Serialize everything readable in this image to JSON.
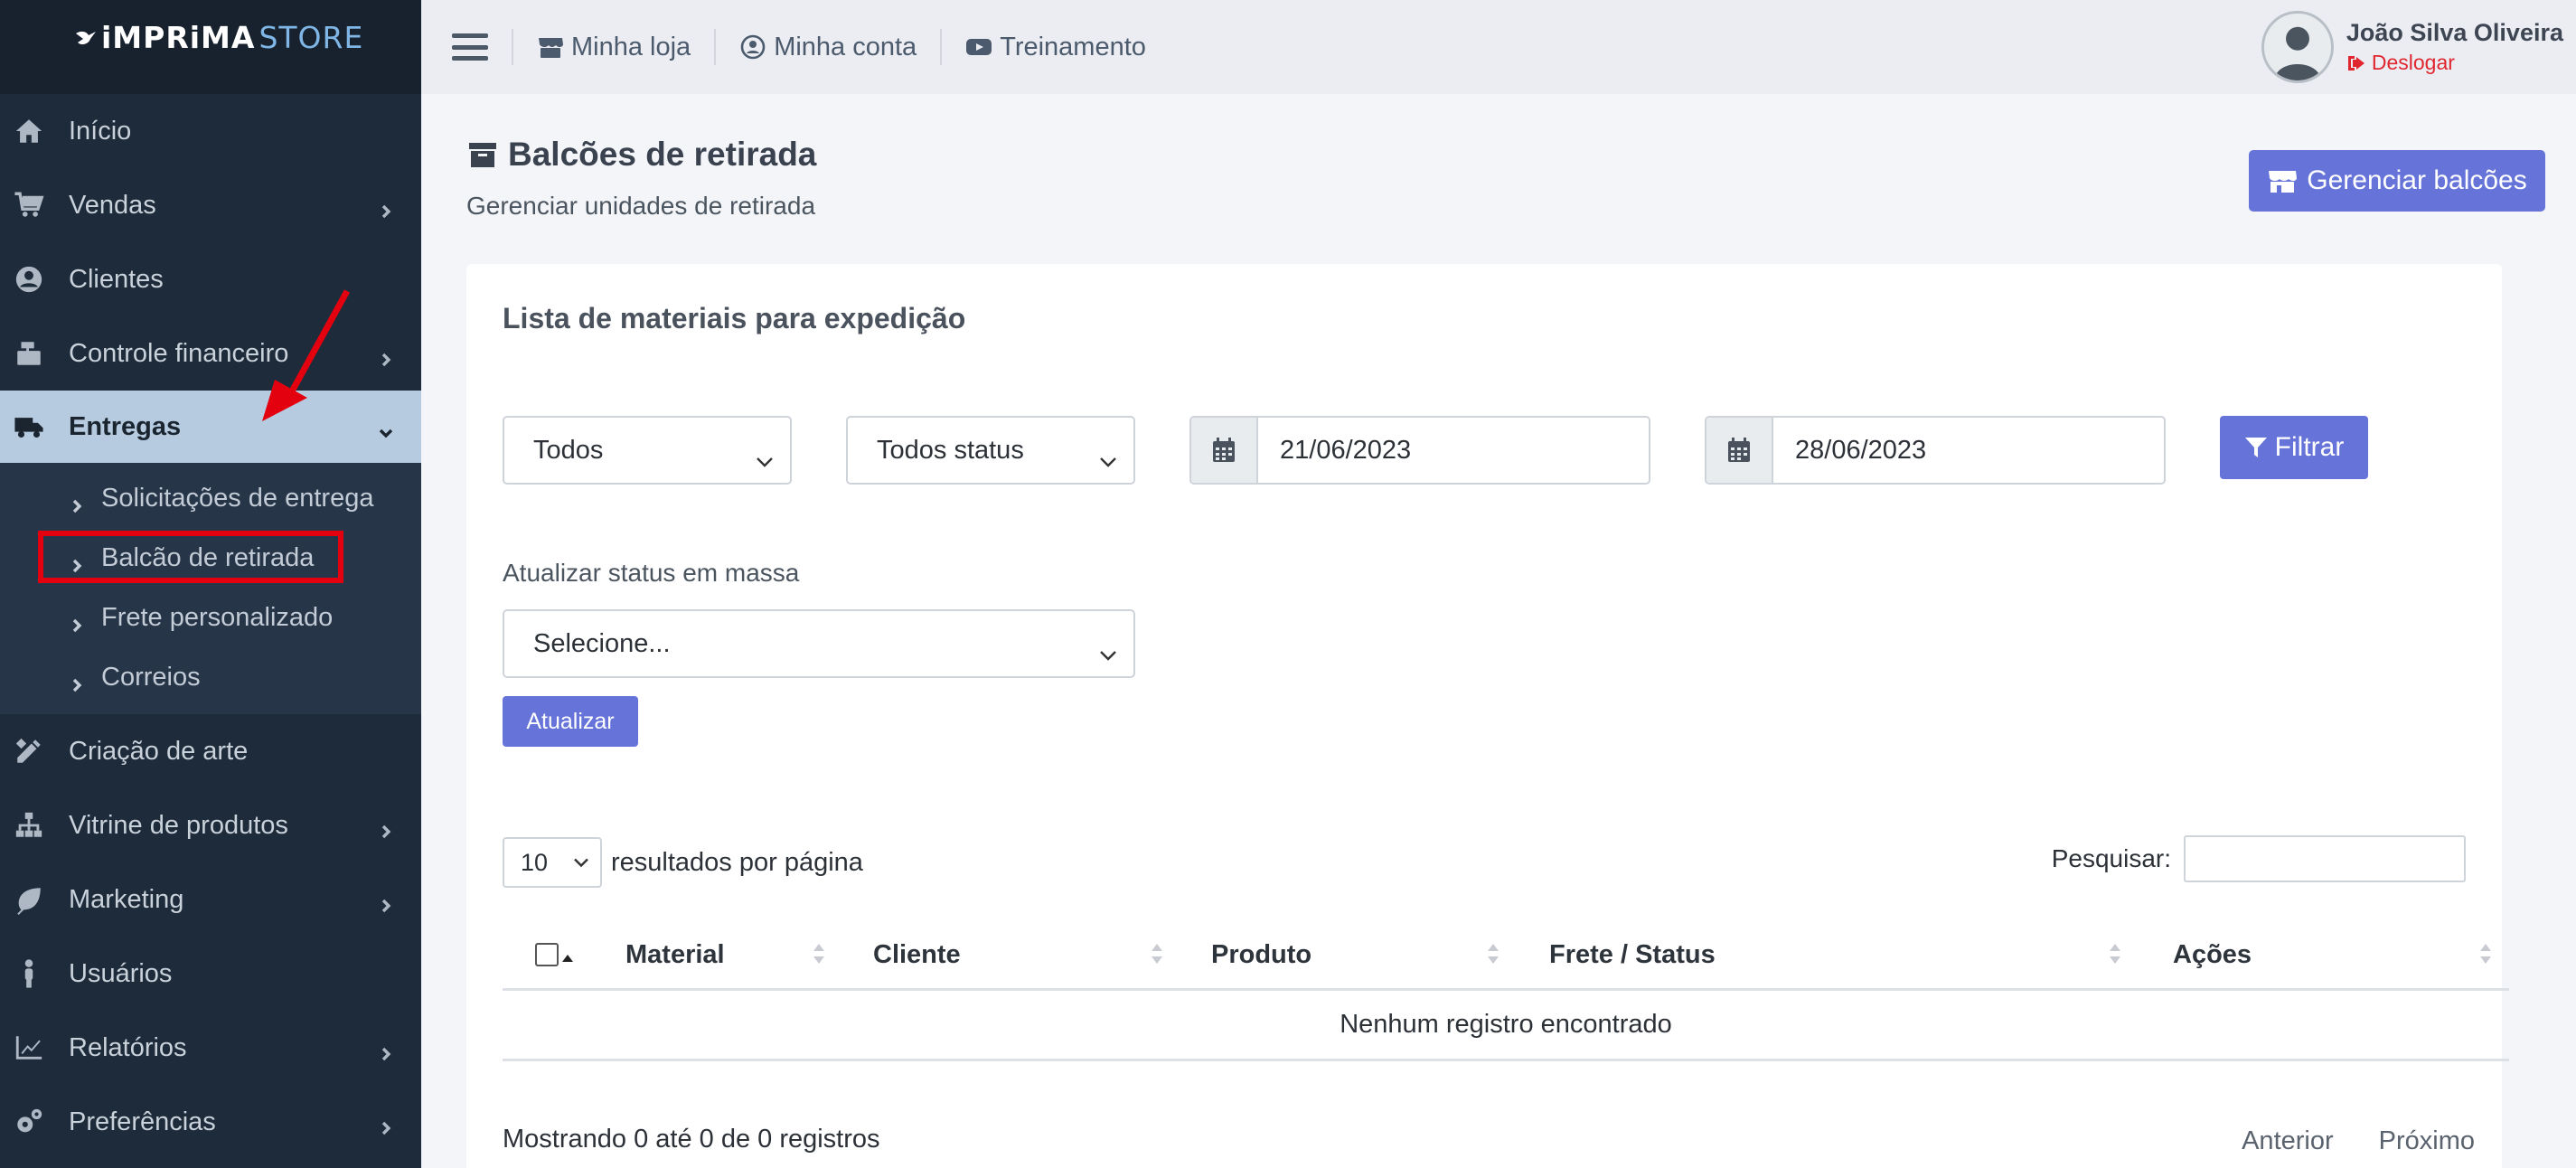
{
  "brand": {
    "part1": "iMPRiMA",
    "part2": "STORE"
  },
  "sidebar": {
    "items": [
      {
        "label": "Início",
        "icon": "home-icon"
      },
      {
        "label": "Vendas",
        "icon": "cart-icon"
      },
      {
        "label": "Clientes",
        "icon": "user-circle-icon"
      },
      {
        "label": "Controle financeiro",
        "icon": "cash-register-icon"
      },
      {
        "label": "Entregas",
        "icon": "truck-icon"
      },
      {
        "label": "Criação de arte",
        "icon": "pencil-ruler-icon"
      },
      {
        "label": "Vitrine de produtos",
        "icon": "sitemap-icon"
      },
      {
        "label": "Marketing",
        "icon": "leaf-icon"
      },
      {
        "label": "Usuários",
        "icon": "person-icon"
      },
      {
        "label": "Relatórios",
        "icon": "chart-line-icon"
      },
      {
        "label": "Preferências",
        "icon": "gears-icon"
      }
    ],
    "submenu": [
      {
        "label": "Solicitações de entrega"
      },
      {
        "label": "Balcão de retirada"
      },
      {
        "label": "Frete personalizado"
      },
      {
        "label": "Correios"
      }
    ]
  },
  "topbar": {
    "links": [
      {
        "label": "Minha loja",
        "icon": "store-icon"
      },
      {
        "label": "Minha conta",
        "icon": "user-circle-icon"
      },
      {
        "label": "Treinamento",
        "icon": "youtube-icon"
      }
    ],
    "user_name": "João Silva Oliveira",
    "logout_label": "Deslogar"
  },
  "page": {
    "title": "Balcões de retirada",
    "subtitle": "Gerenciar unidades de retirada",
    "manage_button": "Gerenciar balcões"
  },
  "card": {
    "title": "Lista de materiais para expedição",
    "filter_type": "Todos",
    "filter_status": "Todos status",
    "date_from": "21/06/2023",
    "date_to": "28/06/2023",
    "filter_button": "Filtrar",
    "mass_label": "Atualizar status em massa",
    "mass_select": "Selecione...",
    "update_button": "Atualizar",
    "page_length": "10",
    "page_length_label": "resultados por página",
    "search_label": "Pesquisar:",
    "columns": [
      "Material",
      "Cliente",
      "Produto",
      "Frete / Status",
      "Ações"
    ],
    "empty_text": "Nenhum registro encontrado",
    "info_text": "Mostrando 0 até 0 de 0 registros",
    "prev_label": "Anterior",
    "next_label": "Próximo"
  }
}
